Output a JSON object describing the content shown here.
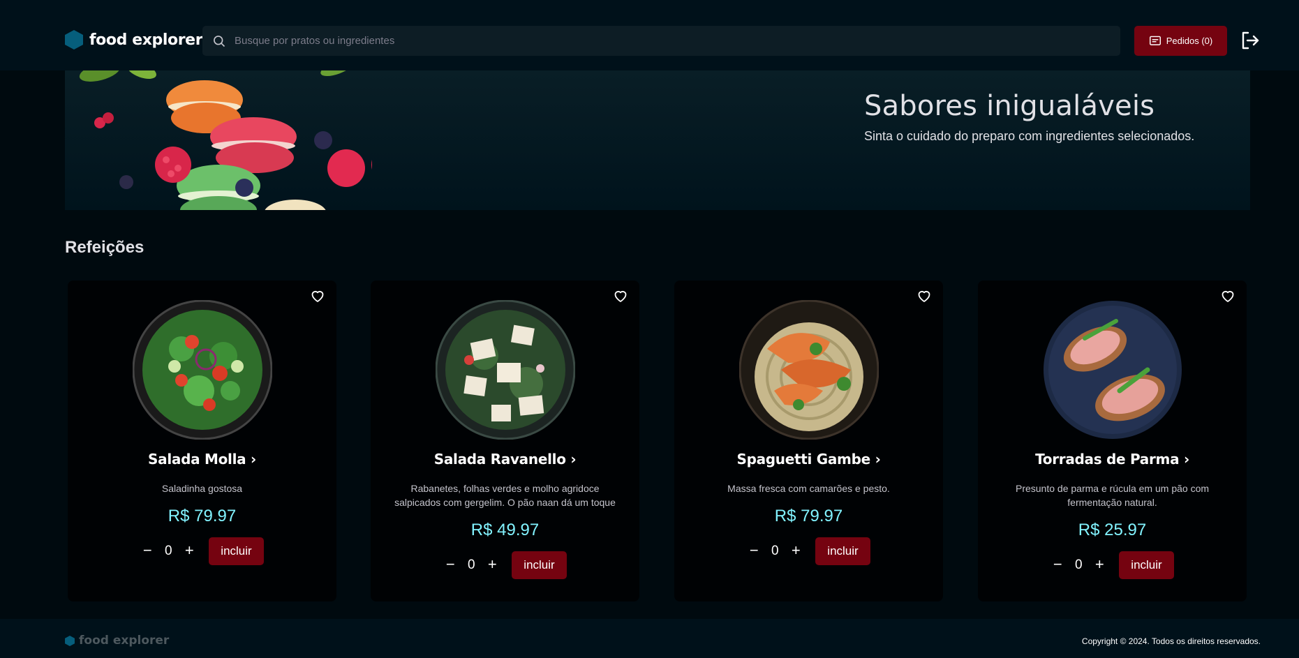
{
  "header": {
    "brand": "food explorer",
    "search_placeholder": "Busque por pratos ou ingredientes",
    "orders_label": "Pedidos (0)"
  },
  "banner": {
    "title": "Sabores inigualáveis",
    "subtitle": "Sinta o cuidado do preparo com ingredientes selecionados."
  },
  "section": {
    "title": "Refeições"
  },
  "dishes": [
    {
      "name": "Salada Molla",
      "description": "Saladinha gostosa",
      "price": "R$ 79.97",
      "quantity": "0",
      "action": "incluir"
    },
    {
      "name": "Salada Ravanello",
      "description": "Rabanetes, folhas verdes e molho agridoce salpicados com gergelim. O pão naan dá um toque",
      "price": "R$ 49.97",
      "quantity": "0",
      "action": "incluir"
    },
    {
      "name": "Spaguetti Gambe",
      "description": "Massa fresca com camarões e pesto.",
      "price": "R$ 79.97",
      "quantity": "0",
      "action": "incluir"
    },
    {
      "name": "Torradas de Parma",
      "description": "Presunto de parma e rúcula em um pão com fermentação natural.",
      "price": "R$ 25.97",
      "quantity": "0",
      "action": "incluir"
    }
  ],
  "footer": {
    "brand": "food explorer",
    "copyright": "Copyright © 2024. Todos os direitos reservados."
  },
  "icons": {
    "brand": "hexagon-icon",
    "search": "search-icon",
    "orders": "receipt-icon",
    "logout": "sign-out-icon",
    "favorite": "heart-icon",
    "chevron": "chevron-right-icon",
    "minus": "minus-icon",
    "plus": "plus-icon"
  },
  "colors": {
    "background": "#000a0f",
    "header": "#00111a",
    "accent_button": "#750310",
    "price": "#82f3ff",
    "brand_icon": "#065e7c"
  }
}
